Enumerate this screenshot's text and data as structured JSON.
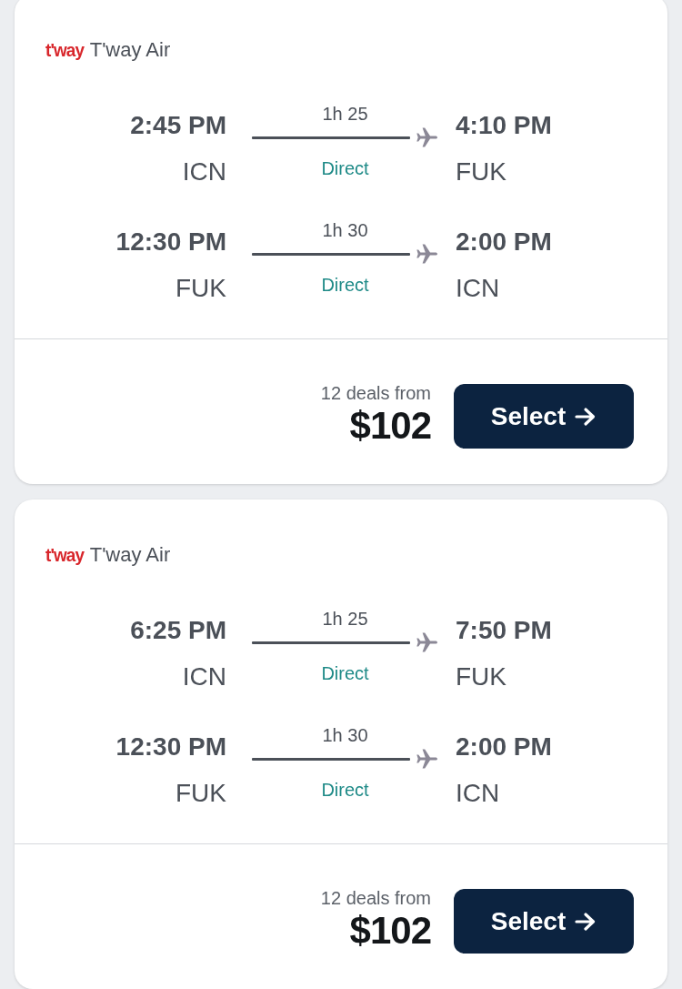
{
  "results": [
    {
      "airline": {
        "logo": "t'way",
        "name": "T'way Air"
      },
      "legs": [
        {
          "depart_time": "2:45 PM",
          "depart_airport": "ICN",
          "duration": "1h 25",
          "stops": "Direct",
          "arrive_time": "4:10 PM",
          "arrive_airport": "FUK"
        },
        {
          "depart_time": "12:30 PM",
          "depart_airport": "FUK",
          "duration": "1h 30",
          "stops": "Direct",
          "arrive_time": "2:00 PM",
          "arrive_airport": "ICN"
        }
      ],
      "deals": "12 deals from",
      "price": "$102",
      "button": "Select"
    },
    {
      "airline": {
        "logo": "t'way",
        "name": "T'way Air"
      },
      "legs": [
        {
          "depart_time": "6:25 PM",
          "depart_airport": "ICN",
          "duration": "1h 25",
          "stops": "Direct",
          "arrive_time": "7:50 PM",
          "arrive_airport": "FUK"
        },
        {
          "depart_time": "12:30 PM",
          "depart_airport": "FUK",
          "duration": "1h 30",
          "stops": "Direct",
          "arrive_time": "2:00 PM",
          "arrive_airport": "ICN"
        }
      ],
      "deals": "12 deals from",
      "price": "$102",
      "button": "Select"
    }
  ]
}
